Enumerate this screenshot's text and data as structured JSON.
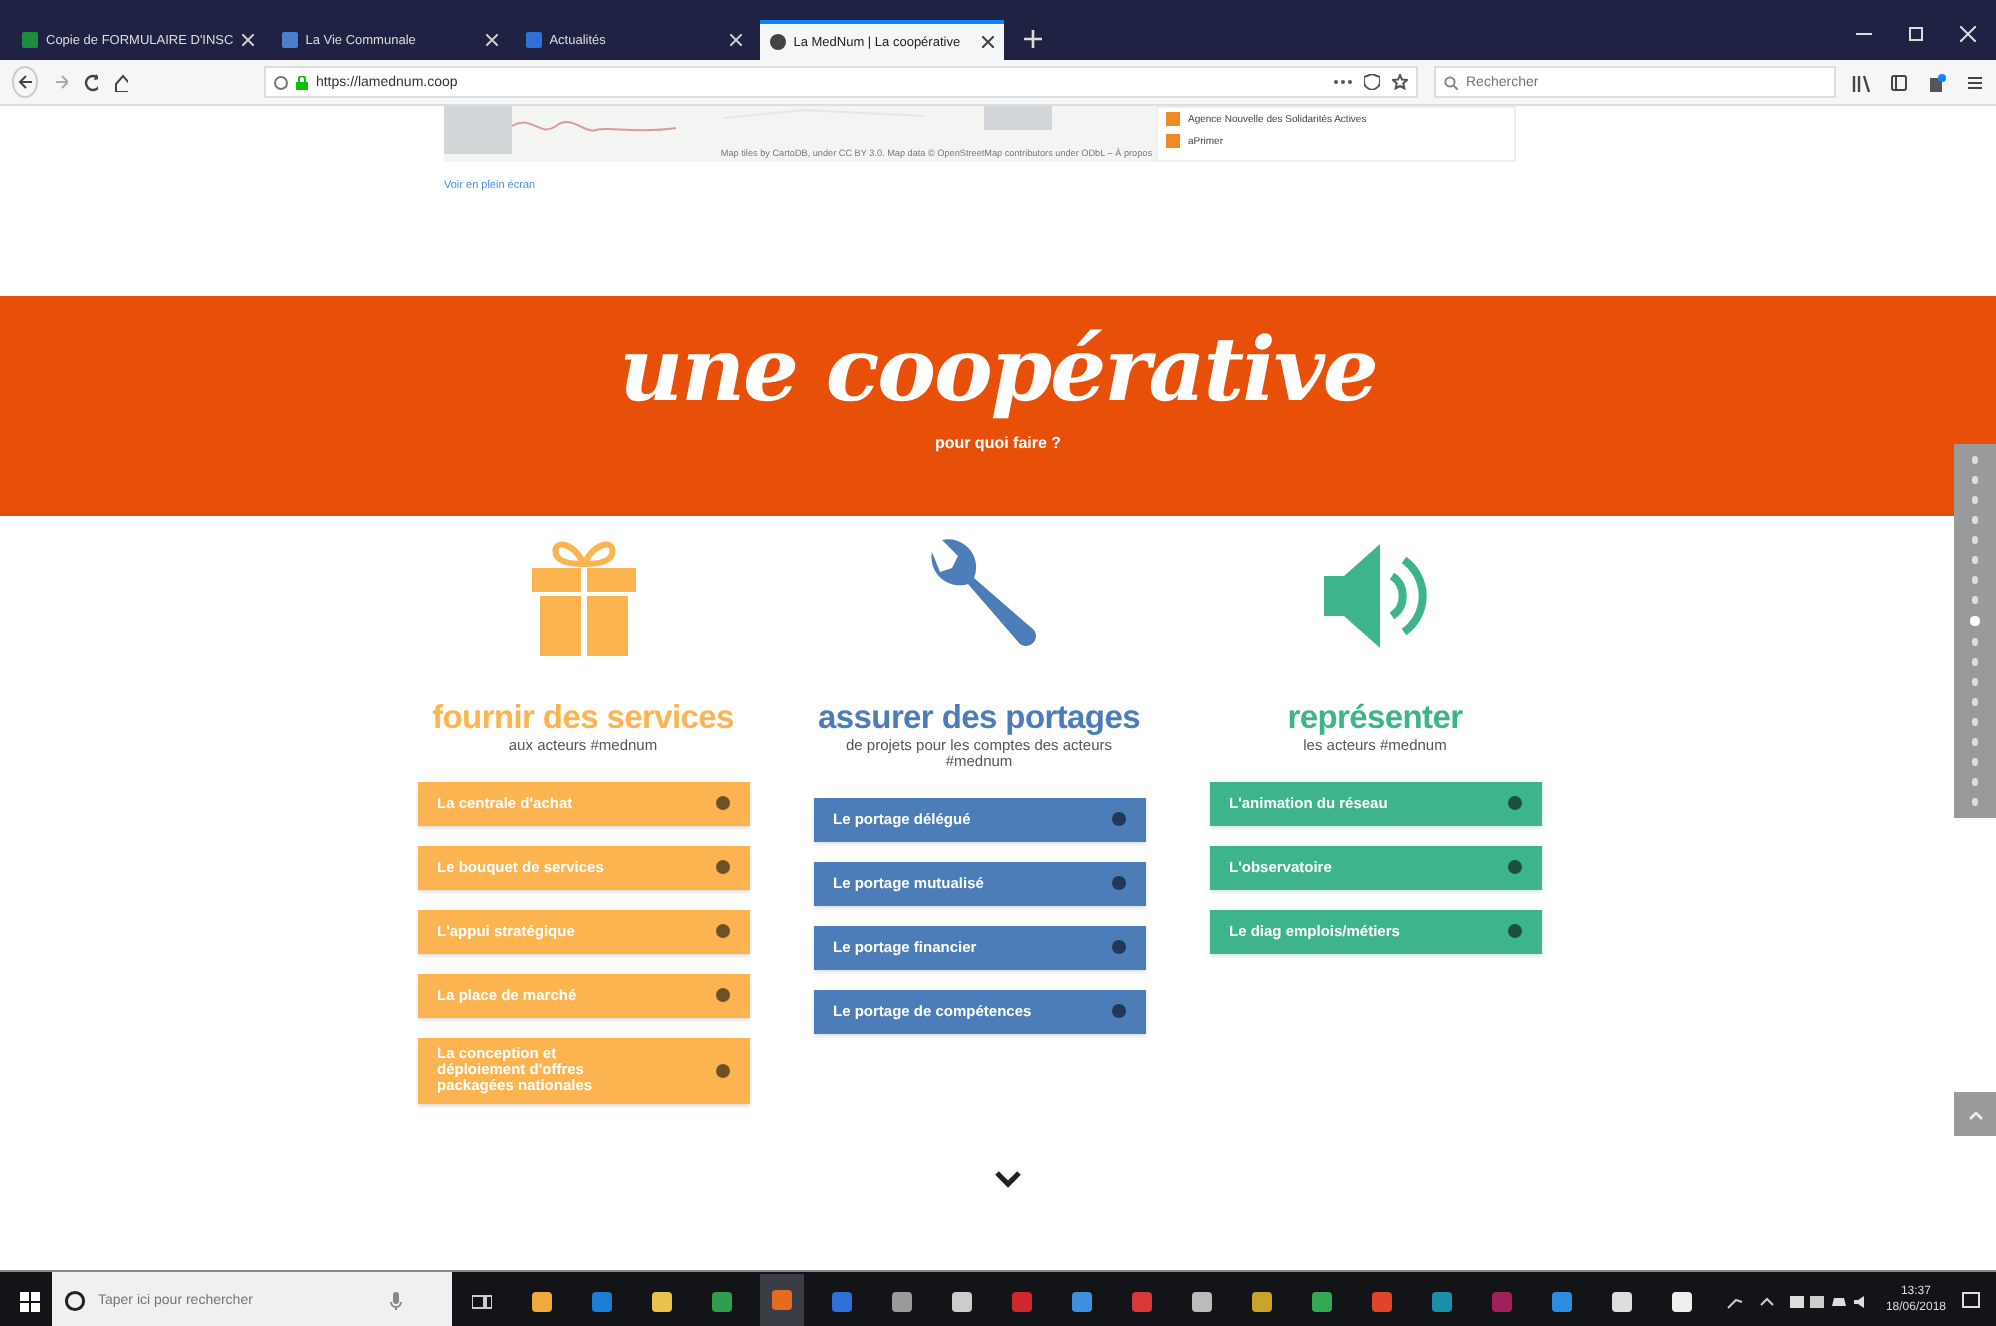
{
  "browser": {
    "tabs": [
      {
        "title": "Copie de FORMULAIRE D'INSC",
        "color": "#1e8e3e",
        "selected": false
      },
      {
        "title": "La Vie Communale",
        "color": "#4a7fd0",
        "selected": false
      },
      {
        "title": "Actualités",
        "color": "#2f6fd6",
        "selected": false
      },
      {
        "title": "La MedNum | La coopérative",
        "color": "#444444",
        "selected": true
      }
    ],
    "url": "https://lamednum.coop",
    "search": {
      "placeholder": "Rechercher"
    }
  },
  "map": {
    "attribution": "Map tiles by CartoDB, under CC BY 3.0. Map data © OpenStreetMap contributors under ODbL – À propos",
    "list": [
      "Agence Nouvelle des Solidarités Actives",
      "aPrimer"
    ],
    "fullscreen_link": "Voir en plein écran"
  },
  "banner": {
    "title": "une coopérative",
    "subtitle": "pour quoi faire ?"
  },
  "columns": [
    {
      "kind": "gift",
      "color": "#fbb450",
      "title": "fournir des services",
      "subtitle": "aux acteurs #mednum",
      "items": [
        "La centrale d'achat",
        "Le bouquet de services",
        "L'appui stratégique",
        "La place de marché",
        "La conception et déploiement d'offres packagées nationales"
      ]
    },
    {
      "kind": "wrench",
      "color": "#4c7db8",
      "title": "assurer des portages",
      "subtitle": "de projets pour les comptes des acteurs #mednum",
      "items": [
        "Le portage délégué",
        "Le portage mutualisé",
        "Le portage financier",
        "Le portage de compétences"
      ]
    },
    {
      "kind": "speaker",
      "color": "#3db48a",
      "title": "représenter",
      "subtitle": "les acteurs #mednum",
      "items": [
        "L'animation du réseau",
        "L'observatoire",
        "Le diag emplois/métiers"
      ]
    }
  ],
  "side_nav": [
    {
      "selected": false
    },
    {
      "selected": false
    },
    {
      "selected": false
    },
    {
      "selected": false
    },
    {
      "selected": false
    },
    {
      "selected": false
    },
    {
      "selected": false
    },
    {
      "selected": false
    },
    {
      "selected": true
    },
    {
      "selected": false
    },
    {
      "selected": false
    },
    {
      "selected": false
    },
    {
      "selected": false
    },
    {
      "selected": false
    },
    {
      "selected": false
    },
    {
      "selected": false
    },
    {
      "selected": false
    },
    {
      "selected": false
    }
  ],
  "taskbar": {
    "search": {
      "placeholder": "Taper ici pour rechercher"
    },
    "apps": [
      {
        "color": "#f2a93b",
        "selected": false
      },
      {
        "color": "#1a7fd4",
        "selected": false
      },
      {
        "color": "#e8c24a",
        "selected": false
      },
      {
        "color": "#2e9e4f",
        "selected": false
      },
      {
        "color": "#e66a1f",
        "selected": true
      },
      {
        "color": "#2f6fd6",
        "selected": false
      },
      {
        "color": "#9a9a9a",
        "selected": false
      },
      {
        "color": "#cccccc",
        "selected": false
      },
      {
        "color": "#d0272e",
        "selected": false
      },
      {
        "color": "#3d8fe0",
        "selected": false
      },
      {
        "color": "#d9383a",
        "selected": false
      },
      {
        "color": "#bbbbbb",
        "selected": false
      },
      {
        "color": "#c9a32a",
        "selected": false
      },
      {
        "color": "#34a853",
        "selected": false
      },
      {
        "color": "#e0452b",
        "selected": false
      },
      {
        "color": "#1c8fa8",
        "selected": false
      },
      {
        "color": "#a0205a",
        "selected": false
      },
      {
        "color": "#2d8ce0",
        "selected": false
      },
      {
        "color": "#dddddd",
        "selected": false
      },
      {
        "color": "#eeeeee",
        "selected": false
      }
    ],
    "time": "13:37",
    "date": "18/06/2018"
  }
}
